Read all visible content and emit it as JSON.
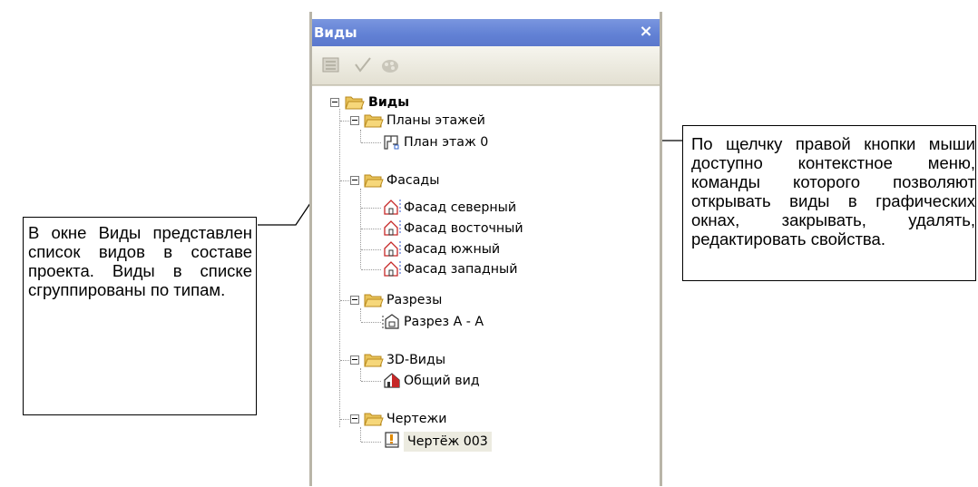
{
  "panel": {
    "title": "Виды",
    "close_glyph": "×",
    "toolbar": [
      {
        "name": "list-icon"
      },
      {
        "name": "check-icon"
      },
      {
        "name": "palette-icon"
      }
    ]
  },
  "tree": {
    "root": {
      "label": "Виды",
      "icon": "folder-open-icon"
    },
    "groups": [
      {
        "label": "Планы этажей",
        "icon": "folder-open-icon",
        "children": [
          {
            "label": "План этаж 0",
            "icon": "floor-plan-icon"
          }
        ]
      },
      {
        "label": "Фасады",
        "icon": "folder-open-icon",
        "children": [
          {
            "label": "Фасад северный",
            "icon": "facade-icon"
          },
          {
            "label": "Фасад восточный",
            "icon": "facade-icon"
          },
          {
            "label": "Фасад южный",
            "icon": "facade-icon"
          },
          {
            "label": "Фасад западный",
            "icon": "facade-icon"
          }
        ]
      },
      {
        "label": "Разрезы",
        "icon": "folder-open-icon",
        "children": [
          {
            "label": "Разрез А - А",
            "icon": "section-icon"
          }
        ]
      },
      {
        "label": "3D-Виды",
        "icon": "folder-open-icon",
        "children": [
          {
            "label": "Общий вид",
            "icon": "3d-view-icon"
          }
        ]
      },
      {
        "label": "Чертежи",
        "icon": "folder-open-icon",
        "children": [
          {
            "label": "Чертёж 003",
            "icon": "drawing-icon",
            "selected": true
          }
        ]
      }
    ]
  },
  "callouts": {
    "left": "В окне Виды представлен список видов в составе проекта. Виды в списке сгруппированы по типам.",
    "right": "По щелчку правой кнопки мыши доступно контекстное меню, команды которого позволяют открывать виды в графических окнах, закрывать, удалять, редактировать свойства."
  }
}
